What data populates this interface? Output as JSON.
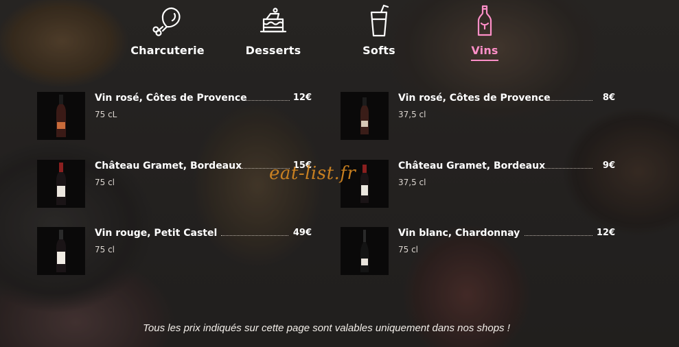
{
  "nav": {
    "categories": [
      {
        "label": "Charcuterie",
        "icon": "ham-leg-icon",
        "active": false
      },
      {
        "label": "Desserts",
        "icon": "cake-icon",
        "active": false
      },
      {
        "label": "Softs",
        "icon": "drink-cup-icon",
        "active": false
      },
      {
        "label": "Vins",
        "icon": "wine-bottle-icon",
        "active": true
      }
    ],
    "active_color": "#ff8fc8"
  },
  "products": [
    {
      "name": "Vin rosé, Côtes de Provence",
      "size": "75 cL",
      "price": "12€",
      "image": "rose-wine-bottle"
    },
    {
      "name": "Vin rosé, Côtes de Provence",
      "size": "37,5 cl",
      "price": "8€",
      "image": "rose-wine-half-bottle"
    },
    {
      "name": "Château Gramet, Bordeaux",
      "size": "75 cl",
      "price": "15€",
      "image": "red-wine-bottle"
    },
    {
      "name": "Château Gramet, Bordeaux",
      "size": "37,5 cl",
      "price": "9€",
      "image": "red-wine-half-bottle"
    },
    {
      "name": "Vin rouge, Petit Castel",
      "size": "75 cl",
      "price": "49€",
      "image": "red-wine-bottle"
    },
    {
      "name": "Vin blanc, Chardonnay",
      "size": "75 cl",
      "price": "12€",
      "image": "white-wine-bottle"
    }
  ],
  "watermark": "eat-list.fr",
  "footer_note": "Tous les prix indiqués sur cette page sont valables uniquement dans nos shops !"
}
